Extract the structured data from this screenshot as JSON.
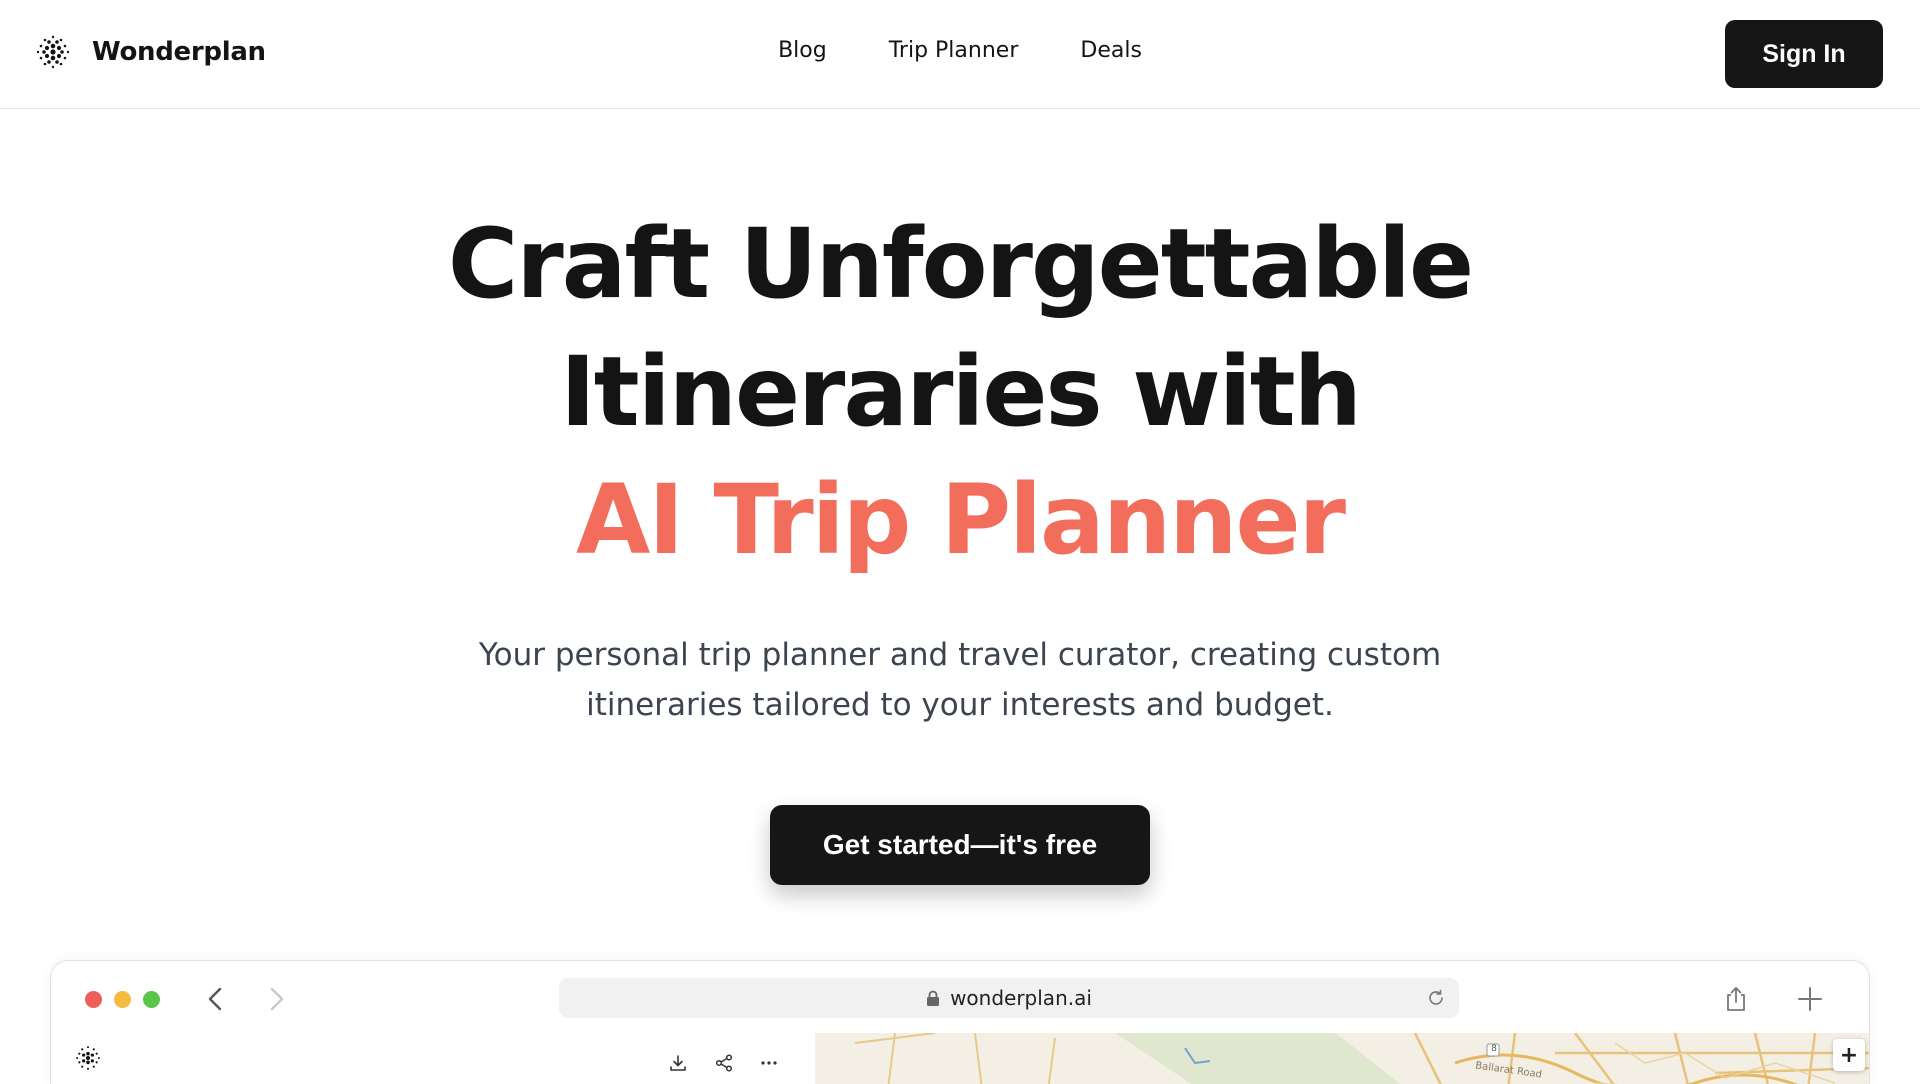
{
  "brand": {
    "name": "Wonderplan",
    "icon": "dot-grid-logo-icon"
  },
  "nav": {
    "items": [
      {
        "label": "Blog"
      },
      {
        "label": "Trip Planner"
      },
      {
        "label": "Deals"
      }
    ]
  },
  "header": {
    "sign_in_label": "Sign In"
  },
  "hero": {
    "headline_line1": "Craft Unforgettable",
    "headline_line2": "Itineraries with",
    "headline_accent": "AI Trip Planner",
    "subtitle_line1": "Your personal trip planner and travel curator, creating custom",
    "subtitle_line2": "itineraries tailored to your interests and budget.",
    "cta_label": "Get started—it's free"
  },
  "browser_mockup": {
    "url": "wonderplan.ai",
    "map_label": "Ballarat Road",
    "map_badge": "8",
    "zoom_in_label": "+"
  },
  "colors": {
    "accent": "#f26d5b",
    "primary_button": "#161616",
    "subtitle_text": "#3c4450"
  }
}
